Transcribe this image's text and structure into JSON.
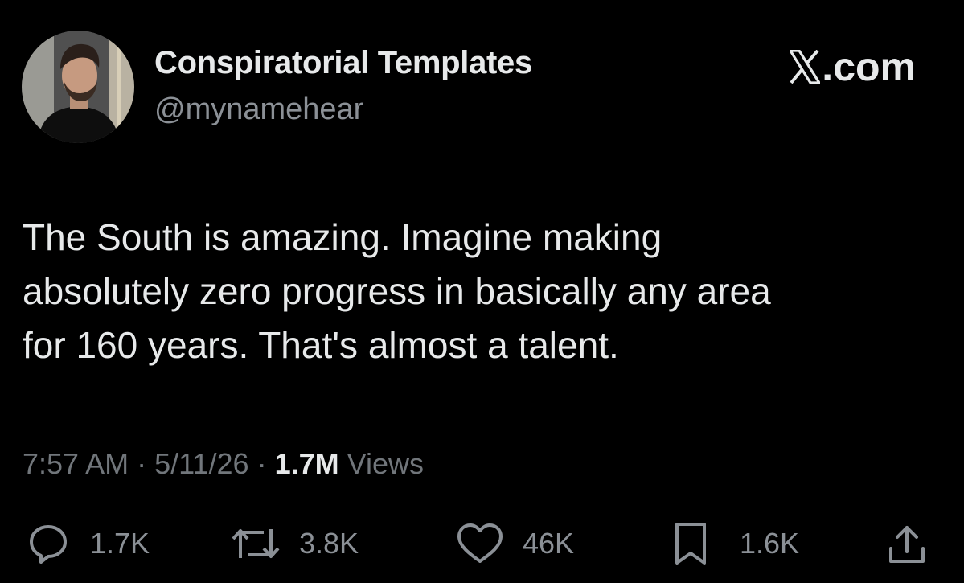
{
  "author": {
    "display_name": "Conspiratorial Templates",
    "handle": "@mynamehear",
    "avatar_icon": "profile-photo"
  },
  "site": {
    "brand_suffix": ".com",
    "brand_icon": "x-logo-icon"
  },
  "tweet": {
    "lines": [
      "The South is amazing. Imagine making",
      "absolutely zero progress in basically any area",
      "for 160 years. That's almost a talent."
    ]
  },
  "meta": {
    "time": "7:57 AM",
    "separator": "·",
    "date": "5/11/26",
    "views_count": "1.7M",
    "views_label": "Views"
  },
  "actions": {
    "replies": "1.7K",
    "reposts": "3.8K",
    "likes": "46K",
    "bookmarks": "1.6K"
  },
  "colors": {
    "background": "#000000",
    "primary_text": "#e7e9ea",
    "secondary_text": "#71767b"
  }
}
